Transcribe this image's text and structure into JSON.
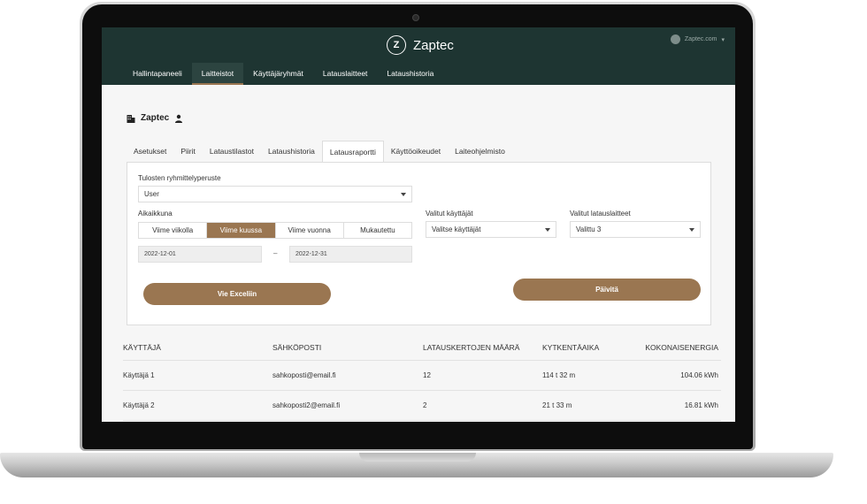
{
  "header": {
    "brand": "Zaptec",
    "logo_letter": "Z",
    "account": "Zaptec.com"
  },
  "nav": [
    {
      "label": "Hallintapaneeli",
      "active": false
    },
    {
      "label": "Laitteistot",
      "active": true
    },
    {
      "label": "Käyttäjäryhmät",
      "active": false
    },
    {
      "label": "Latauslaitteet",
      "active": false
    },
    {
      "label": "Lataushistoria",
      "active": false
    }
  ],
  "site": {
    "title": "Zaptec"
  },
  "tabs": [
    {
      "label": "Asetukset",
      "active": false
    },
    {
      "label": "Piirit",
      "active": false
    },
    {
      "label": "Lataustilastot",
      "active": false
    },
    {
      "label": "Lataushistoria",
      "active": false
    },
    {
      "label": "Latausraportti",
      "active": true
    },
    {
      "label": "Käyttöoikeudet",
      "active": false
    },
    {
      "label": "Laiteohjelmisto",
      "active": false
    }
  ],
  "report": {
    "grouping_label": "Tulosten ryhmittelyperuste",
    "grouping_value": "User",
    "timeframe_label": "Aikaikkuna",
    "timeframe_options": [
      {
        "label": "Viime viikolla",
        "active": false
      },
      {
        "label": "Viime kuussa",
        "active": true
      },
      {
        "label": "Viime vuonna",
        "active": false
      },
      {
        "label": "Mukautettu",
        "active": false
      }
    ],
    "date_from": "2022-12-01",
    "date_sep": "–",
    "date_to": "2022-12-31",
    "users_label": "Valitut käyttäjät",
    "users_value": "Valitse käyttäjät",
    "chargers_label": "Valitut latauslaitteet",
    "chargers_value": "Valittu 3",
    "export_label": "Vie Exceliin",
    "update_label": "Päivitä"
  },
  "table": {
    "columns": [
      "KÄYTTÄJÄ",
      "SÄHKÖPOSTI",
      "LATAUSKERTOJEN MÄÄRÄ",
      "KYTKENTÄAIKA",
      "KOKONAISENERGIA"
    ],
    "rows": [
      [
        "Käyttäjä 1",
        "sahkoposti@email.fi",
        "12",
        "114 t 32 m",
        "104.06 kWh"
      ],
      [
        "Käyttäjä 2",
        "sahkoposti2@email.fi",
        "2",
        "21 t 33 m",
        "16.81 kWh"
      ]
    ]
  }
}
